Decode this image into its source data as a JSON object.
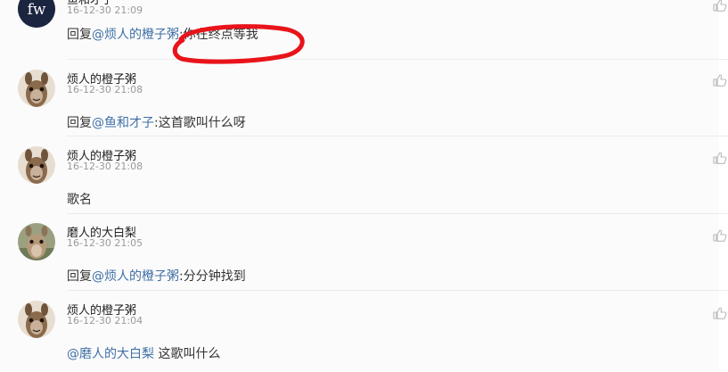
{
  "comments": [
    {
      "username": "鱼和才子",
      "time": "16-12-30 21:09",
      "reply_prefix": "回复",
      "mention": "@烦人的橙子粥",
      "separator": ":",
      "text": "你在终点等我",
      "avatar": "fw-logo-avatar",
      "avatar_text": "fw"
    },
    {
      "username": "烦人的橙子粥",
      "time": "16-12-30 21:08",
      "reply_prefix": "回复",
      "mention": "@鱼和才子",
      "separator": ":",
      "text": "这首歌叫什么呀",
      "avatar": "alpaca-avatar"
    },
    {
      "username": "烦人的橙子粥",
      "time": "16-12-30 21:08",
      "reply_prefix": "",
      "mention": "",
      "separator": "",
      "text": "歌名",
      "avatar": "alpaca-avatar"
    },
    {
      "username": "磨人的大白梨",
      "time": "16-12-30 21:05",
      "reply_prefix": "回复",
      "mention": "@烦人的橙子粥",
      "separator": ":",
      "text": "分分钟找到",
      "avatar": "llama-avatar"
    },
    {
      "username": "烦人的橙子粥",
      "time": "16-12-30 21:04",
      "reply_prefix": "",
      "mention": "@磨人的大白梨",
      "separator": " ",
      "text": "这歌叫什么",
      "avatar": "alpaca-avatar"
    }
  ],
  "icons": {
    "like": "thumbs-up-icon"
  },
  "colors": {
    "mention": "#3f6fa6",
    "annotation": "#e8141a",
    "timestamp": "#9a9a9a"
  }
}
